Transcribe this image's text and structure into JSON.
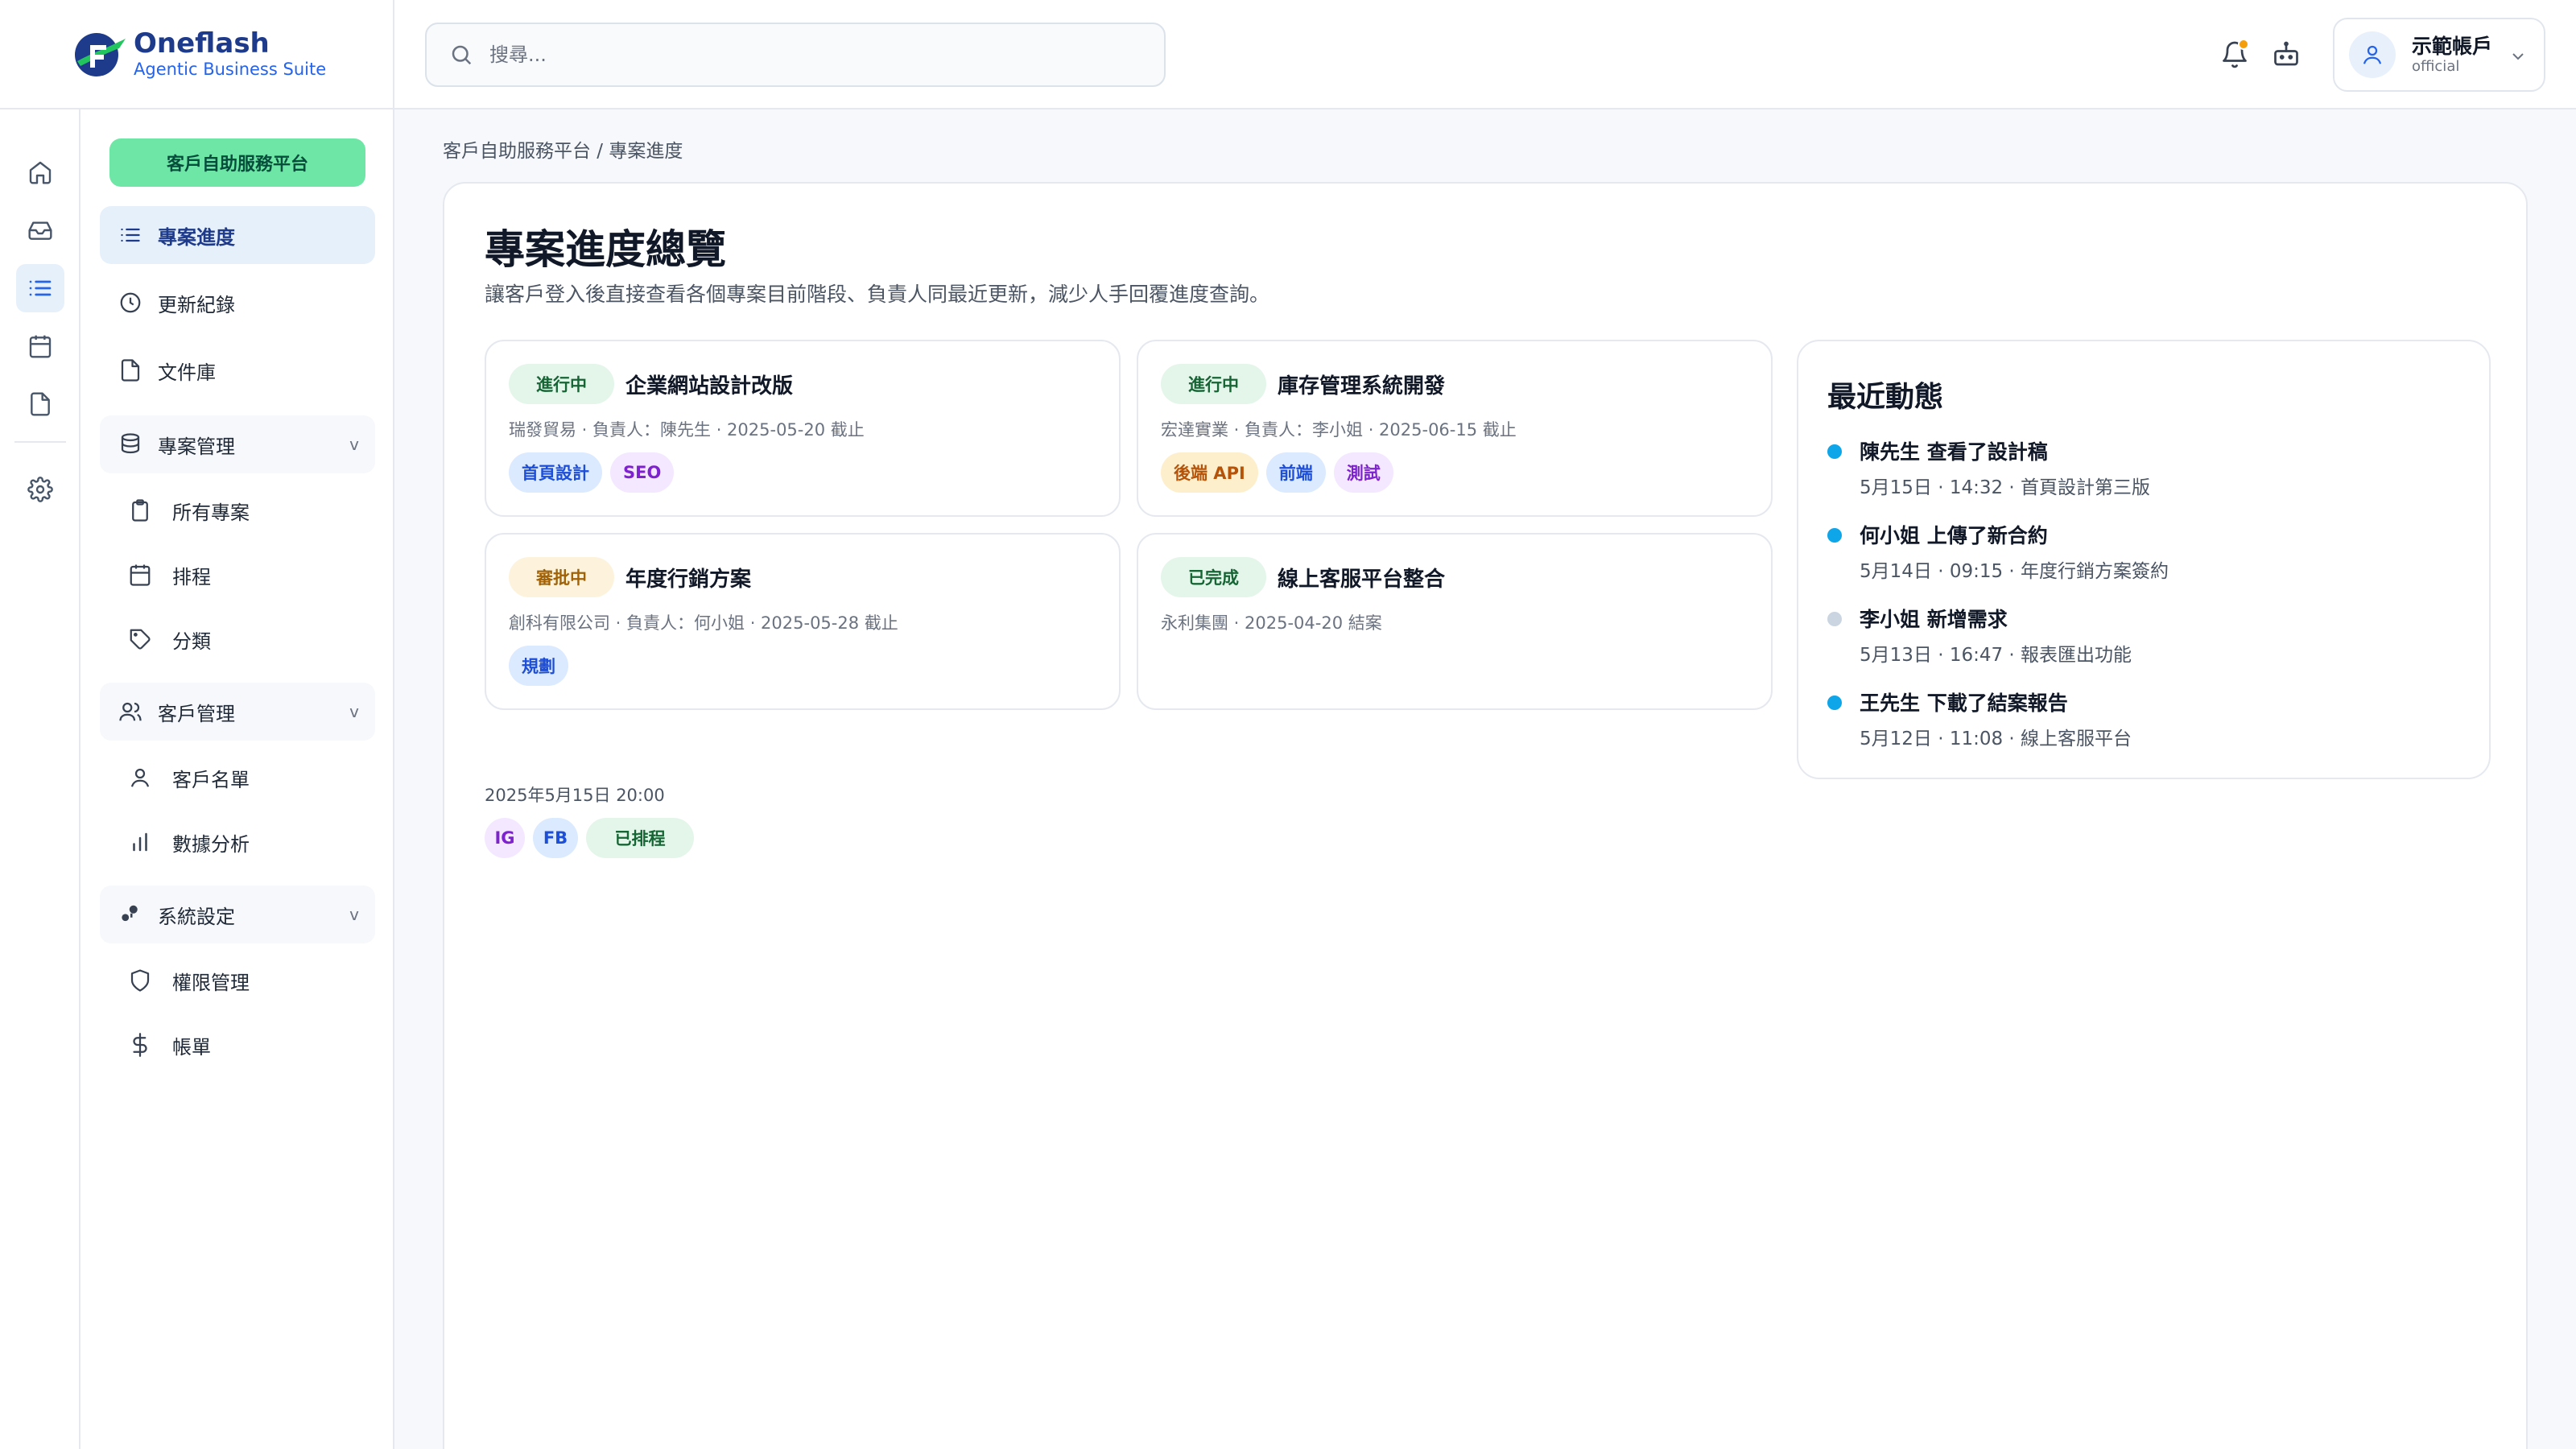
{
  "brand": {
    "name": "Oneflash",
    "tagline": "Agentic Business Suite"
  },
  "search": {
    "placeholder": "搜尋..."
  },
  "account": {
    "name": "示範帳戶",
    "sub": "official"
  },
  "sidebar": {
    "platform_button": "客戶自助服務平台",
    "items": [
      {
        "label": "專案進度",
        "icon": "list-icon"
      },
      {
        "label": "更新紀錄",
        "icon": "clock-icon"
      },
      {
        "label": "文件庫",
        "icon": "file-icon"
      },
      {
        "label": "專案管理",
        "icon": "database-icon"
      },
      {
        "label": "所有專案",
        "icon": "clipboard-icon"
      },
      {
        "label": "排程",
        "icon": "calendar-icon"
      },
      {
        "label": "分類",
        "icon": "tag-icon"
      },
      {
        "label": "客戶管理",
        "icon": "users-icon"
      },
      {
        "label": "客戶名單",
        "icon": "user-icon"
      },
      {
        "label": "數據分析",
        "icon": "bar-chart-icon"
      },
      {
        "label": "系統設定",
        "icon": "settings-icon"
      },
      {
        "label": "權限管理",
        "icon": "shield-icon"
      },
      {
        "label": "帳單",
        "icon": "dollar-icon"
      }
    ],
    "chevron": "v"
  },
  "breadcrumb": "客戶自助服務平台 / 專案進度",
  "main": {
    "title": "專案進度總覽",
    "subtitle": "讓客戶登入後直接查看各個專案目前階段、負責人同最近更新，減少人手回覆進度查詢。"
  },
  "projects": [
    {
      "status": "進行中",
      "title": "企業網站設計改版",
      "meta": "瑞發貿易 · 負責人：陳先生 · 2025-05-20 截止",
      "tags": [
        "首頁設計",
        "SEO"
      ]
    },
    {
      "status": "進行中",
      "title": "庫存管理系統開發",
      "meta": "宏達實業 · 負責人：李小姐 · 2025-06-15 截止",
      "tags": [
        "後端 API",
        "前端",
        "測試"
      ]
    },
    {
      "status": "審批中",
      "title": "年度行銷方案",
      "meta": "創科有限公司 · 負責人：何小姐 · 2025-05-28 截止",
      "tags": [
        "規劃"
      ]
    },
    {
      "status": "已完成",
      "title": "線上客服平台整合",
      "meta": "永利集團 · 2025-04-20 結案",
      "tags": []
    }
  ],
  "activity": {
    "title": "最近動態",
    "items": [
      {
        "main": "陳先生 查看了設計稿",
        "sub": "5月15日 · 14:32 · 首頁設計第三版",
        "color": "#0ea5e9"
      },
      {
        "main": "何小姐 上傳了新合約",
        "sub": "5月14日 · 09:15 · 年度行銷方案簽約",
        "color": "#0ea5e9"
      },
      {
        "main": "李小姐 新增需求",
        "sub": "5月13日 · 16:47 · 報表匯出功能",
        "color": "#cbd5e1"
      },
      {
        "main": "王先生 下載了結案報告",
        "sub": "5月12日 · 11:08 · 線上客服平台",
        "color": "#0ea5e9"
      }
    ]
  },
  "schedule": {
    "datetime": "2025年5月15日 20:00",
    "tags": [
      "IG",
      "FB",
      "已排程"
    ]
  },
  "colors": {
    "accent": "#2563eb",
    "brand_green": "#6ee7a6",
    "active_bg": "#e6f0fb",
    "notif": "#f59e0b"
  }
}
